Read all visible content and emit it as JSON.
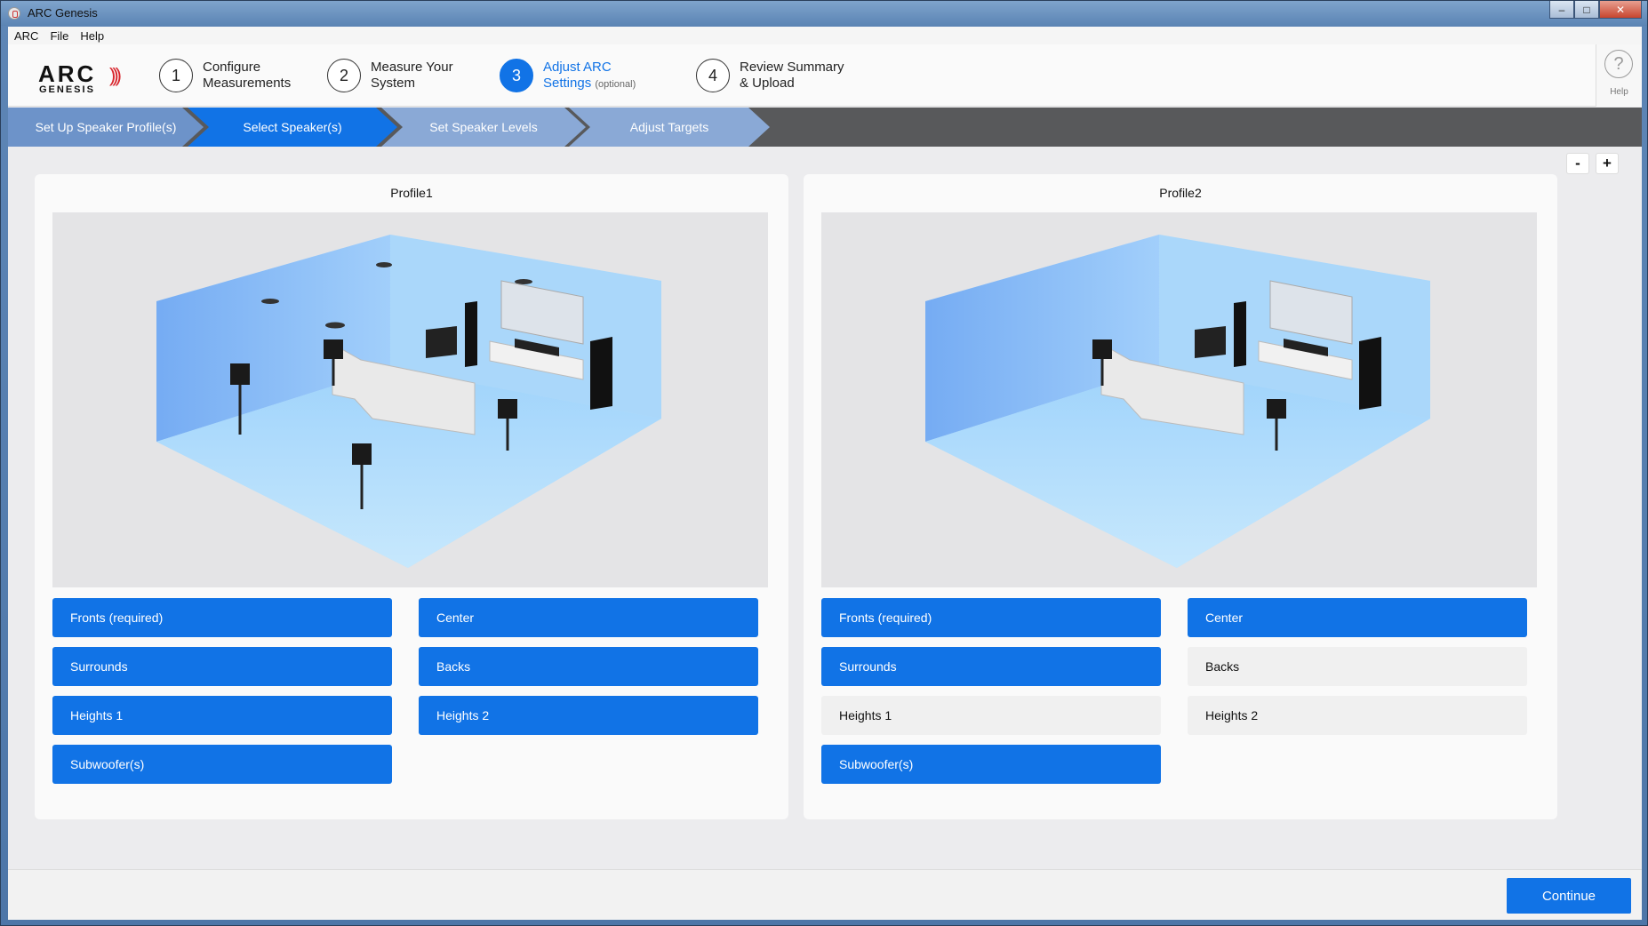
{
  "window": {
    "title": "ARC Genesis"
  },
  "menu": [
    "ARC",
    "File",
    "Help"
  ],
  "logo": {
    "text_main": "ARC",
    "text_sub": "GENESIS"
  },
  "steps": [
    {
      "num": "1",
      "line1": "Configure",
      "line2": "Measurements",
      "note": ""
    },
    {
      "num": "2",
      "line1": "Measure Your",
      "line2": "System",
      "note": ""
    },
    {
      "num": "3",
      "line1": "Adjust ARC",
      "line2": "Settings",
      "note": "(optional)"
    },
    {
      "num": "4",
      "line1": "Review Summary",
      "line2": "& Upload",
      "note": ""
    }
  ],
  "help": {
    "label": "Help",
    "glyph": "?"
  },
  "breadcrumbs": [
    "Set Up Speaker Profile(s)",
    "Select Speaker(s)",
    "Set Speaker Levels",
    "Adjust Targets"
  ],
  "zoom": {
    "minus": "-",
    "plus": "+"
  },
  "profiles": [
    {
      "title": "Profile1",
      "buttons": [
        {
          "label": "Fronts (required)",
          "selected": true
        },
        {
          "label": "Center",
          "selected": true
        },
        {
          "label": "Surrounds",
          "selected": true
        },
        {
          "label": "Backs",
          "selected": true
        },
        {
          "label": "Heights 1",
          "selected": true
        },
        {
          "label": "Heights 2",
          "selected": true
        },
        {
          "label": "Subwoofer(s)",
          "selected": true
        }
      ]
    },
    {
      "title": "Profile2",
      "buttons": [
        {
          "label": "Fronts (required)",
          "selected": true
        },
        {
          "label": "Center",
          "selected": true
        },
        {
          "label": "Surrounds",
          "selected": true
        },
        {
          "label": "Backs",
          "selected": false
        },
        {
          "label": "Heights 1",
          "selected": false
        },
        {
          "label": "Heights 2",
          "selected": false
        },
        {
          "label": "Subwoofer(s)",
          "selected": true
        }
      ]
    }
  ],
  "footer": {
    "continue_label": "Continue"
  },
  "colors": {
    "accent": "#1173e6",
    "room_fill": "#8fc6ff"
  }
}
